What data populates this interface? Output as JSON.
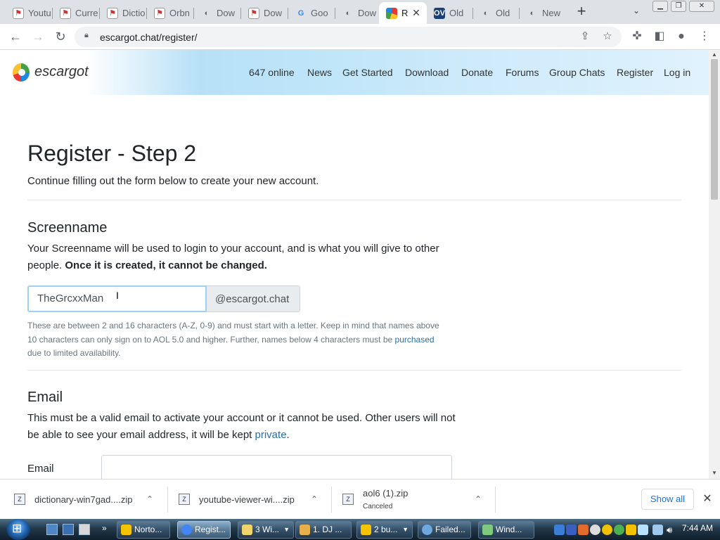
{
  "browser": {
    "tabs": [
      {
        "title": "Youtu",
        "icon": "windows-flag-icon"
      },
      {
        "title": "Curre",
        "icon": "windows-flag-icon"
      },
      {
        "title": "Dictio",
        "icon": "windows-flag-icon"
      },
      {
        "title": "Orbn",
        "icon": "windows-flag-icon"
      },
      {
        "title": "Dow",
        "icon": "globe-icon"
      },
      {
        "title": "Dow",
        "icon": "windows-flag-icon"
      },
      {
        "title": "Goo",
        "icon": "google-icon"
      },
      {
        "title": "Dow",
        "icon": "globe-icon"
      },
      {
        "title": "R",
        "icon": "escargot-icon",
        "active": true,
        "close": "✕"
      },
      {
        "title": "Old",
        "icon": "oldversion-icon"
      },
      {
        "title": "Old",
        "icon": "globe-icon"
      },
      {
        "title": "New",
        "icon": "globe-icon"
      }
    ],
    "new_tab_glyph": "+",
    "url": "escargot.chat/register/"
  },
  "site": {
    "logo_text": "escargot",
    "nav": [
      "647 online",
      "News",
      "Get Started",
      "Download",
      "Donate",
      "Forums",
      "Group Chats",
      "Register",
      "Log in"
    ]
  },
  "page": {
    "title": "Register - Step 2",
    "subtitle": "Continue filling out the form below to create your new account.",
    "screenname": {
      "heading": "Screenname",
      "desc_plain": "Your Screenname will be used to login to your account, and is what you will give to other people. ",
      "desc_bold": "Once it is created, it cannot be changed.",
      "input_value": "TheGrcxxMan",
      "addon": "@escargot.chat",
      "help_pre": "These are between 2 and 16 characters (A-Z, 0-9) and must start with a letter. Keep in mind that names above 10 characters can only sign on to AOL 5.0 and higher. Further, names below 4 characters must be ",
      "help_link": "purchased",
      "help_post": " due to limited availability."
    },
    "email": {
      "heading": "Email",
      "desc_pre": "This must be a valid email to activate your account or it cannot be used. Other users will not be able to see your email address, it will be kept ",
      "desc_link": "private",
      "desc_post": ".",
      "label": "Email",
      "input_value": ""
    }
  },
  "downloads": {
    "items": [
      {
        "name": "dictionary-win7gad....zip",
        "status": ""
      },
      {
        "name": "youtube-viewer-wi....zip",
        "status": ""
      },
      {
        "name": "aol6 (1).zip",
        "status": "Canceled"
      }
    ],
    "show_all": "Show all"
  },
  "taskbar": {
    "buttons": [
      {
        "label": "Norto...",
        "icon_color": "#f5c400"
      },
      {
        "label": "Regist...",
        "icon_color": "#4285f4",
        "active": true
      },
      {
        "label": "3 Wi...",
        "icon_color": "#f1d36b"
      },
      {
        "label": "1. DJ ...",
        "icon_color": "#e8b04a"
      },
      {
        "label": "2 bu...",
        "icon_color": "#f5c400"
      },
      {
        "label": "Failed...",
        "icon_color": "#6fa8dc"
      },
      {
        "label": "Wind...",
        "icon_color": "#7fc97f"
      }
    ],
    "clock": "7:44 AM"
  }
}
